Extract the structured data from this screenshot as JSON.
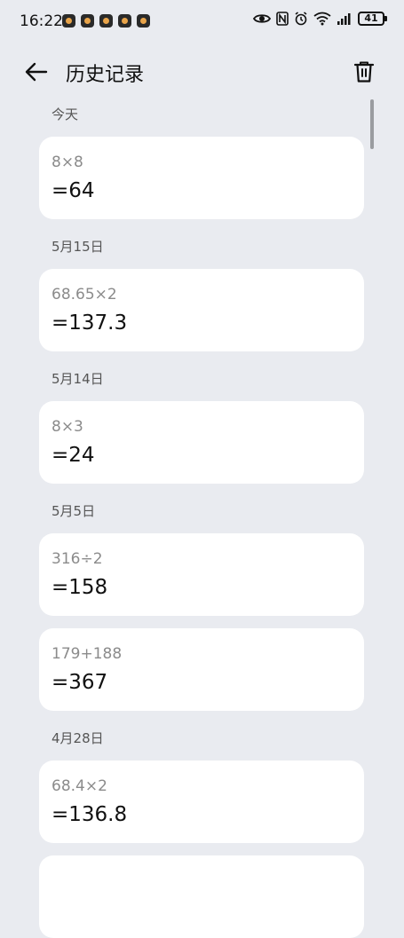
{
  "status_bar": {
    "time": "16:22",
    "battery": "41"
  },
  "header": {
    "title": "历史记录"
  },
  "groups": [
    {
      "date": "今天",
      "items": [
        {
          "expression": "8×8",
          "result": "=64"
        }
      ]
    },
    {
      "date": "5月15日",
      "items": [
        {
          "expression": "68.65×2",
          "result": "=137.3"
        }
      ]
    },
    {
      "date": "5月14日",
      "items": [
        {
          "expression": "8×3",
          "result": "=24"
        }
      ]
    },
    {
      "date": "5月5日",
      "items": [
        {
          "expression": "316÷2",
          "result": "=158"
        },
        {
          "expression": "179+188",
          "result": "=367"
        }
      ]
    },
    {
      "date": "4月28日",
      "items": [
        {
          "expression": "68.4×2",
          "result": "=136.8"
        },
        {
          "expression": "",
          "result": ""
        }
      ]
    }
  ]
}
